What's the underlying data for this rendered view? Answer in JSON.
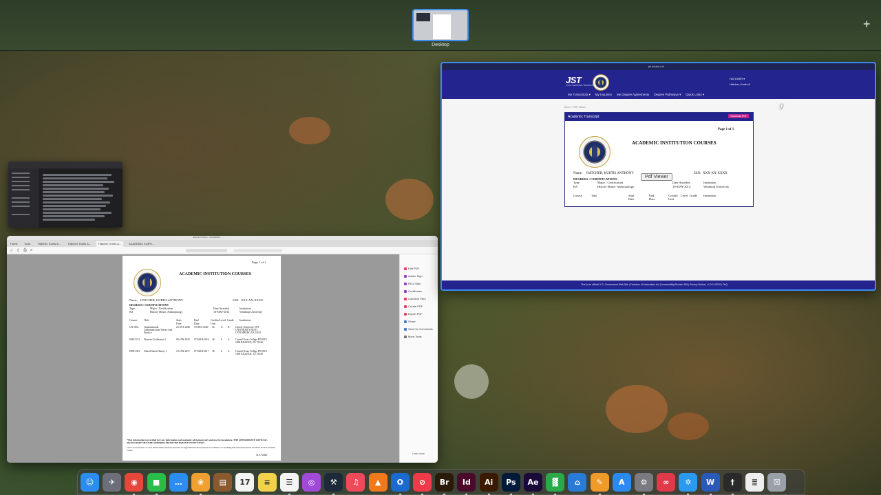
{
  "mission_control": {
    "space_label": "Desktop",
    "add_space_symbol": "+"
  },
  "acrobat": {
    "window_title": "Hatcher Kurtis A - ACADEMIC...",
    "tabs": [
      "Home",
      "Tools",
      "Hatcher, Kurtis A...",
      "Hatcher, Kurtis A...",
      "Hatcher, Kurtis A...",
      "ACADEMIC KURTI..."
    ],
    "right_panel": [
      "Edit PDF",
      "Adobe Sign",
      "Fill & Sign",
      "Certificates",
      "Combine Files",
      "Create PDF",
      "Export PDF",
      "Share",
      "Send for Comments",
      "More Tools"
    ],
    "right_panel_footer": "Learn more"
  },
  "transcript": {
    "page_indicator": "Page 1 of 1",
    "heading": "ACADEMIC INSTITUTION COURSES",
    "name_label": "Name:",
    "name_value": "HATCHER, KURTIS ANTHONY",
    "ssn_label": "SSN:",
    "ssn_value": "XXX-XX-XXXX",
    "degrees_heading": "DEGREES / CERTIFICATIONS",
    "degree_cols": [
      "Type",
      "Major / Certification",
      "Date Awarded",
      "Institution"
    ],
    "degree_row": [
      "BA",
      "History Minor: Anthropology",
      "10-MAY-2014",
      "Winthrop University"
    ],
    "course_cols": [
      "Course",
      "Title",
      "Start Date",
      "End Date",
      "Credits/ Unit",
      "Level",
      "Grade",
      "Institution"
    ],
    "courses": [
      [
        "UN 5635",
        "Organizational Communication Theory And Practice",
        "26-OCT-2020",
        "19-DEC-2020",
        "3S",
        "G",
        "B",
        "Liberty University 1971 UNIVERSITY BLVD LYNCHBURG VA 24515"
      ],
      [
        "HIST1311",
        "Western Civilization I",
        "09-JAN-2016",
        "07-MAR-2016",
        "3S",
        "L",
        "A",
        "Central Texas College PO BOX 1800 KILLEEN, TX 76540"
      ],
      [
        "HIST1301",
        "United States History I",
        "10-JAN-2017",
        "07-MAR-2017",
        "3S",
        "L",
        "A",
        "Central Texas College PO BOX 1800 KILLEEN, TX 76540"
      ]
    ],
    "footnote": "*This information is provided for your information and academic advisement only and may be incomplete. THE APPROPRIATE OFFICIAL TRANSCRIPT MUST BE ORDERED FROM THE PARENT INSTITUTION.",
    "legend": "Level: V=Vocational L=Lower Division Baccalaureate/Associate U=Upper Division Baccalaureate G=Graduate C=Continuing Education Professional Certificate N=Non-Standard Course",
    "date": "11/17/2020"
  },
  "browser": {
    "url": "jst.doded.mil",
    "brand": "JST",
    "brand_sub": "JOINT SERVICES TRANSCRIPT",
    "user_name": "HATCHER ▾",
    "user_sub": "Hatcher, Kurtis A",
    "nav": [
      "My Transcripts ▾",
      "My Inquiries",
      "My Degree Agreements",
      "Degree Pathways ▾",
      "Quick Links ▾"
    ],
    "breadcrumb": "Home > PDF Viewer",
    "viewer_title": "Academic Transcript",
    "viewer_button": "Download PDF",
    "tooltip": "Pdf Viewer",
    "footer": "This is an official U.S. Government Web Site | Freedom of Information Act | Accessibility/Section 508 | Privacy Notice | v1.0 11/2020 | FAQ"
  },
  "dock": {
    "apps": [
      {
        "name": "finder-icon",
        "glyph": "☺",
        "color": "#2d8cf0"
      },
      {
        "name": "launchpad-icon",
        "glyph": "✈",
        "color": "#6c6f7a"
      },
      {
        "name": "chrome-icon",
        "glyph": "◉",
        "color": "#e8463a"
      },
      {
        "name": "facetime-icon",
        "glyph": "■",
        "color": "#2bbd4a"
      },
      {
        "name": "messages-icon",
        "glyph": "…",
        "color": "#2d8cf0"
      },
      {
        "name": "photos-icon",
        "glyph": "❀",
        "color": "#f0a030"
      },
      {
        "name": "notefile-icon",
        "glyph": "▤",
        "color": "#8a5a2e"
      },
      {
        "name": "calendar-icon",
        "glyph": "17",
        "color": "#f4f4f4"
      },
      {
        "name": "notes-icon",
        "glyph": "≡",
        "color": "#f2d24a"
      },
      {
        "name": "reminders-icon",
        "glyph": "☰",
        "color": "#f4f4f4"
      },
      {
        "name": "podcasts-icon",
        "glyph": "◎",
        "color": "#a24ad8"
      },
      {
        "name": "xcode-icon",
        "glyph": "⚒",
        "color": "#1d2a3a"
      },
      {
        "name": "music-icon",
        "glyph": "♫",
        "color": "#f04a5a"
      },
      {
        "name": "vlc-icon",
        "glyph": "▲",
        "color": "#f07a1a"
      },
      {
        "name": "outlook-icon",
        "glyph": "O",
        "color": "#1a6ad0"
      },
      {
        "name": "news-icon",
        "glyph": "⊘",
        "color": "#f03a4a"
      },
      {
        "name": "bridge-icon",
        "glyph": "Br",
        "color": "#2a1a0a"
      },
      {
        "name": "indesign-icon",
        "glyph": "Id",
        "color": "#4a0a2a"
      },
      {
        "name": "illustrator-icon",
        "glyph": "Ai",
        "color": "#3a1a00"
      },
      {
        "name": "photoshop-icon",
        "glyph": "Ps",
        "color": "#001a3a"
      },
      {
        "name": "aftereffects-icon",
        "glyph": "Ae",
        "color": "#1a0a3a"
      },
      {
        "name": "numbers-icon",
        "glyph": "▓",
        "color": "#2aa84a"
      },
      {
        "name": "keynote-icon",
        "glyph": "⌂",
        "color": "#2a7ad8"
      },
      {
        "name": "pages-icon",
        "glyph": "✎",
        "color": "#f09a2a"
      },
      {
        "name": "appstore-icon",
        "glyph": "A",
        "color": "#2a8af0"
      },
      {
        "name": "settings-icon",
        "glyph": "⚙",
        "color": "#7a7a80"
      },
      {
        "name": "creativecloud-icon",
        "glyph": "∞",
        "color": "#e03a4a"
      },
      {
        "name": "safari-icon",
        "glyph": "✲",
        "color": "#2a9af0"
      },
      {
        "name": "word-icon",
        "glyph": "W",
        "color": "#2a5ab8"
      },
      {
        "name": "acrobat-icon",
        "glyph": "†",
        "color": "#2a2a2a"
      },
      {
        "name": "textedit-icon",
        "glyph": "≣",
        "color": "#eeeeee"
      },
      {
        "name": "trash-icon",
        "glyph": "☒",
        "color": "#9aa0a8"
      }
    ]
  }
}
